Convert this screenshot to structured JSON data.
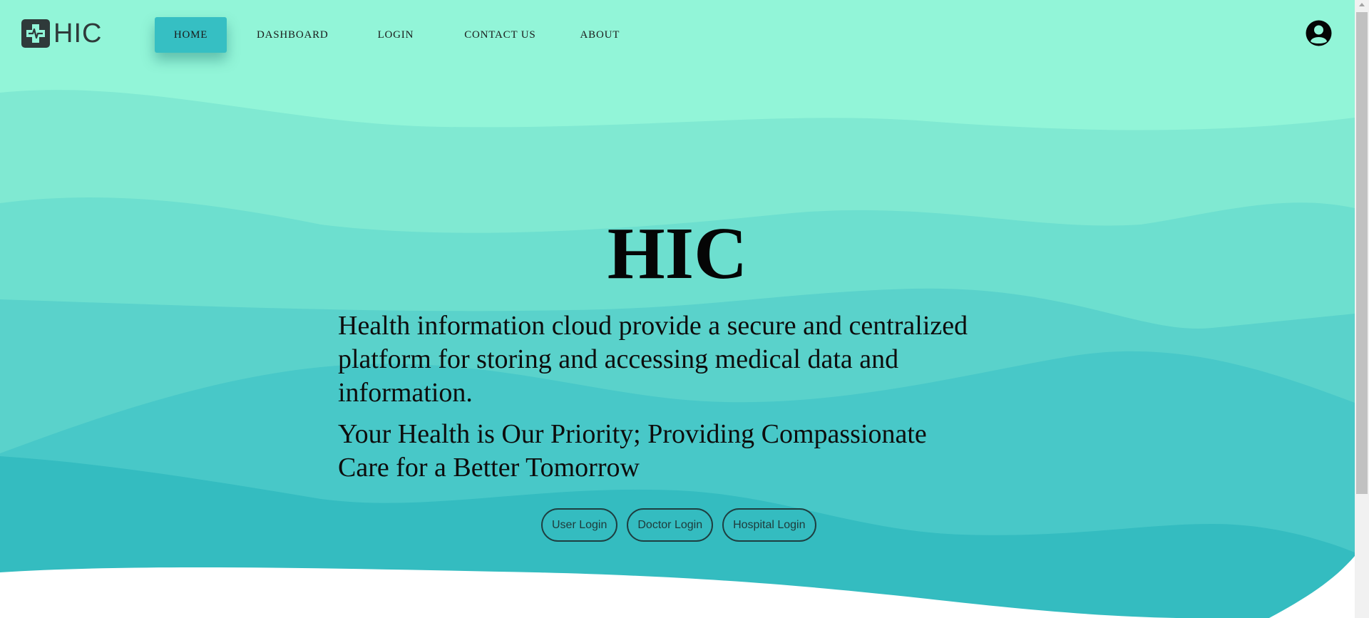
{
  "brand": {
    "logo_text": "HIC"
  },
  "nav": {
    "items": [
      {
        "label": "HOME",
        "active": true
      },
      {
        "label": "DASHBOARD",
        "active": false
      },
      {
        "label": "LOGIN",
        "active": false
      },
      {
        "label": "CONTACT US",
        "active": false
      },
      {
        "label": "ABOUT",
        "active": false
      }
    ],
    "account_icon": "user-circle-icon"
  },
  "hero": {
    "title": "HIC",
    "description": "Health information cloud provide a secure and centralized platform for storing and accessing medical data and information.",
    "tagline": "Your Health is Our Priority; Providing Compassionate Care for a Better Tomorrow",
    "buttons": [
      {
        "label": "User Login"
      },
      {
        "label": "Doctor Login"
      },
      {
        "label": "Hospital Login"
      }
    ]
  },
  "colors": {
    "wave_1": "#92f5d8",
    "wave_2": "#80e9d2",
    "wave_3": "#6ddfcf",
    "wave_4": "#5ad2cb",
    "wave_5": "#48c8c8",
    "wave_6": "#34bcc0",
    "active_nav": "#36bfc3",
    "text": "#0d0d0d"
  }
}
